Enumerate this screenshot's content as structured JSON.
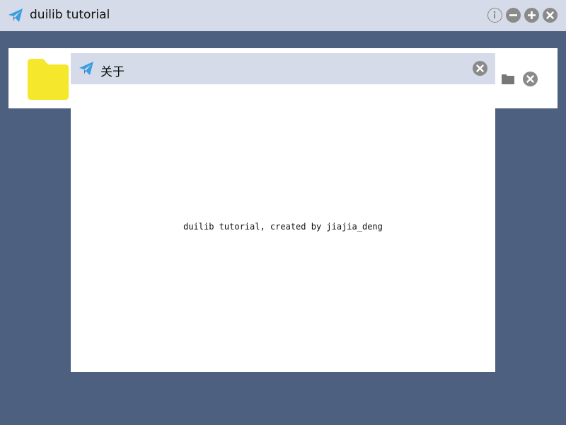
{
  "window": {
    "title": "duilib tutorial",
    "icons": {
      "logo": "paper-plane-icon",
      "info": "info-icon",
      "minimize": "minus-circle-icon",
      "maximize": "plus-circle-icon",
      "close": "close-circle-icon"
    }
  },
  "panel": {
    "icons": {
      "folder_large": "folder-icon",
      "folder_small": "folder-icon",
      "close": "close-circle-icon"
    }
  },
  "about_dialog": {
    "title": "关于",
    "message": "duilib tutorial, created by jiajia_deng",
    "icons": {
      "logo": "paper-plane-icon",
      "close": "close-circle-icon"
    }
  },
  "colors": {
    "background": "#4e6080",
    "titlebar": "#d5dbe8",
    "folder": "#f5e82c",
    "icon_gray": "#8a8a8a",
    "logo_blue": "#3a9ee0"
  }
}
